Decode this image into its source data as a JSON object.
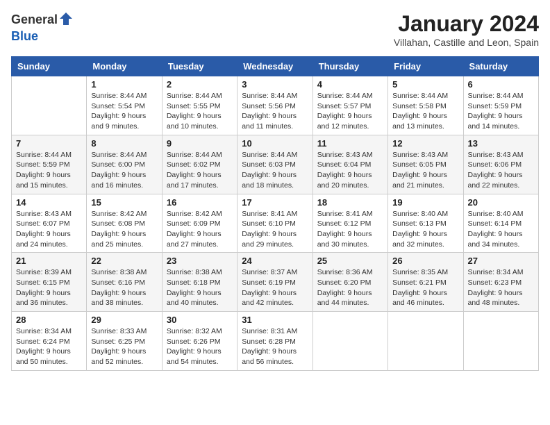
{
  "logo": {
    "general": "General",
    "blue": "Blue"
  },
  "header": {
    "month_year": "January 2024",
    "location": "Villahan, Castille and Leon, Spain"
  },
  "weekdays": [
    "Sunday",
    "Monday",
    "Tuesday",
    "Wednesday",
    "Thursday",
    "Friday",
    "Saturday"
  ],
  "weeks": [
    [
      {
        "day": "",
        "sunrise": "",
        "sunset": "",
        "daylight": ""
      },
      {
        "day": "1",
        "sunrise": "Sunrise: 8:44 AM",
        "sunset": "Sunset: 5:54 PM",
        "daylight": "Daylight: 9 hours and 9 minutes."
      },
      {
        "day": "2",
        "sunrise": "Sunrise: 8:44 AM",
        "sunset": "Sunset: 5:55 PM",
        "daylight": "Daylight: 9 hours and 10 minutes."
      },
      {
        "day": "3",
        "sunrise": "Sunrise: 8:44 AM",
        "sunset": "Sunset: 5:56 PM",
        "daylight": "Daylight: 9 hours and 11 minutes."
      },
      {
        "day": "4",
        "sunrise": "Sunrise: 8:44 AM",
        "sunset": "Sunset: 5:57 PM",
        "daylight": "Daylight: 9 hours and 12 minutes."
      },
      {
        "day": "5",
        "sunrise": "Sunrise: 8:44 AM",
        "sunset": "Sunset: 5:58 PM",
        "daylight": "Daylight: 9 hours and 13 minutes."
      },
      {
        "day": "6",
        "sunrise": "Sunrise: 8:44 AM",
        "sunset": "Sunset: 5:59 PM",
        "daylight": "Daylight: 9 hours and 14 minutes."
      }
    ],
    [
      {
        "day": "7",
        "sunrise": "Sunrise: 8:44 AM",
        "sunset": "Sunset: 5:59 PM",
        "daylight": "Daylight: 9 hours and 15 minutes."
      },
      {
        "day": "8",
        "sunrise": "Sunrise: 8:44 AM",
        "sunset": "Sunset: 6:00 PM",
        "daylight": "Daylight: 9 hours and 16 minutes."
      },
      {
        "day": "9",
        "sunrise": "Sunrise: 8:44 AM",
        "sunset": "Sunset: 6:02 PM",
        "daylight": "Daylight: 9 hours and 17 minutes."
      },
      {
        "day": "10",
        "sunrise": "Sunrise: 8:44 AM",
        "sunset": "Sunset: 6:03 PM",
        "daylight": "Daylight: 9 hours and 18 minutes."
      },
      {
        "day": "11",
        "sunrise": "Sunrise: 8:43 AM",
        "sunset": "Sunset: 6:04 PM",
        "daylight": "Daylight: 9 hours and 20 minutes."
      },
      {
        "day": "12",
        "sunrise": "Sunrise: 8:43 AM",
        "sunset": "Sunset: 6:05 PM",
        "daylight": "Daylight: 9 hours and 21 minutes."
      },
      {
        "day": "13",
        "sunrise": "Sunrise: 8:43 AM",
        "sunset": "Sunset: 6:06 PM",
        "daylight": "Daylight: 9 hours and 22 minutes."
      }
    ],
    [
      {
        "day": "14",
        "sunrise": "Sunrise: 8:43 AM",
        "sunset": "Sunset: 6:07 PM",
        "daylight": "Daylight: 9 hours and 24 minutes."
      },
      {
        "day": "15",
        "sunrise": "Sunrise: 8:42 AM",
        "sunset": "Sunset: 6:08 PM",
        "daylight": "Daylight: 9 hours and 25 minutes."
      },
      {
        "day": "16",
        "sunrise": "Sunrise: 8:42 AM",
        "sunset": "Sunset: 6:09 PM",
        "daylight": "Daylight: 9 hours and 27 minutes."
      },
      {
        "day": "17",
        "sunrise": "Sunrise: 8:41 AM",
        "sunset": "Sunset: 6:10 PM",
        "daylight": "Daylight: 9 hours and 29 minutes."
      },
      {
        "day": "18",
        "sunrise": "Sunrise: 8:41 AM",
        "sunset": "Sunset: 6:12 PM",
        "daylight": "Daylight: 9 hours and 30 minutes."
      },
      {
        "day": "19",
        "sunrise": "Sunrise: 8:40 AM",
        "sunset": "Sunset: 6:13 PM",
        "daylight": "Daylight: 9 hours and 32 minutes."
      },
      {
        "day": "20",
        "sunrise": "Sunrise: 8:40 AM",
        "sunset": "Sunset: 6:14 PM",
        "daylight": "Daylight: 9 hours and 34 minutes."
      }
    ],
    [
      {
        "day": "21",
        "sunrise": "Sunrise: 8:39 AM",
        "sunset": "Sunset: 6:15 PM",
        "daylight": "Daylight: 9 hours and 36 minutes."
      },
      {
        "day": "22",
        "sunrise": "Sunrise: 8:38 AM",
        "sunset": "Sunset: 6:16 PM",
        "daylight": "Daylight: 9 hours and 38 minutes."
      },
      {
        "day": "23",
        "sunrise": "Sunrise: 8:38 AM",
        "sunset": "Sunset: 6:18 PM",
        "daylight": "Daylight: 9 hours and 40 minutes."
      },
      {
        "day": "24",
        "sunrise": "Sunrise: 8:37 AM",
        "sunset": "Sunset: 6:19 PM",
        "daylight": "Daylight: 9 hours and 42 minutes."
      },
      {
        "day": "25",
        "sunrise": "Sunrise: 8:36 AM",
        "sunset": "Sunset: 6:20 PM",
        "daylight": "Daylight: 9 hours and 44 minutes."
      },
      {
        "day": "26",
        "sunrise": "Sunrise: 8:35 AM",
        "sunset": "Sunset: 6:21 PM",
        "daylight": "Daylight: 9 hours and 46 minutes."
      },
      {
        "day": "27",
        "sunrise": "Sunrise: 8:34 AM",
        "sunset": "Sunset: 6:23 PM",
        "daylight": "Daylight: 9 hours and 48 minutes."
      }
    ],
    [
      {
        "day": "28",
        "sunrise": "Sunrise: 8:34 AM",
        "sunset": "Sunset: 6:24 PM",
        "daylight": "Daylight: 9 hours and 50 minutes."
      },
      {
        "day": "29",
        "sunrise": "Sunrise: 8:33 AM",
        "sunset": "Sunset: 6:25 PM",
        "daylight": "Daylight: 9 hours and 52 minutes."
      },
      {
        "day": "30",
        "sunrise": "Sunrise: 8:32 AM",
        "sunset": "Sunset: 6:26 PM",
        "daylight": "Daylight: 9 hours and 54 minutes."
      },
      {
        "day": "31",
        "sunrise": "Sunrise: 8:31 AM",
        "sunset": "Sunset: 6:28 PM",
        "daylight": "Daylight: 9 hours and 56 minutes."
      },
      {
        "day": "",
        "sunrise": "",
        "sunset": "",
        "daylight": ""
      },
      {
        "day": "",
        "sunrise": "",
        "sunset": "",
        "daylight": ""
      },
      {
        "day": "",
        "sunrise": "",
        "sunset": "",
        "daylight": ""
      }
    ]
  ]
}
